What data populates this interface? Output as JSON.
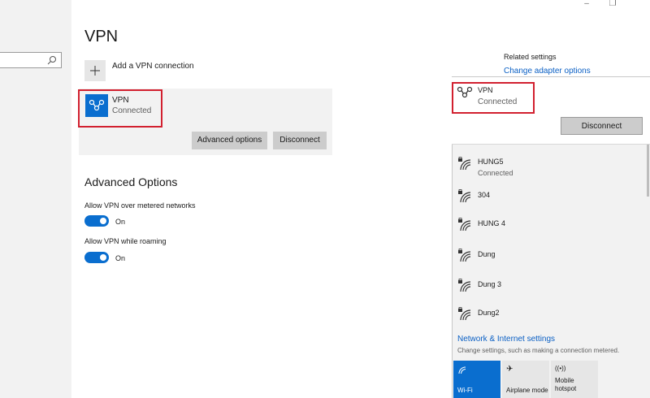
{
  "window_controls": {
    "minimize": "–",
    "restore": "❐"
  },
  "page": {
    "title": "VPN"
  },
  "add_vpn": {
    "label": "Add a VPN connection",
    "icon": "plus-icon"
  },
  "vpn_connection": {
    "name": "VPN",
    "status": "Connected",
    "icon": "vpn-icon",
    "advanced_button": "Advanced options",
    "disconnect_button": "Disconnect"
  },
  "advanced": {
    "title": "Advanced Options",
    "metered": {
      "label": "Allow VPN over metered networks",
      "state": "On",
      "on": true
    },
    "roaming": {
      "label": "Allow VPN while roaming",
      "state": "On",
      "on": true
    }
  },
  "related": {
    "title": "Related settings",
    "link": "Change adapter options"
  },
  "flyout": {
    "vpn": {
      "name": "VPN",
      "status": "Connected",
      "disconnect_button": "Disconnect"
    },
    "networks": [
      {
        "name": "HUNG5",
        "status": "Connected"
      },
      {
        "name": "304",
        "status": ""
      },
      {
        "name": "HUNG 4",
        "status": ""
      },
      {
        "name": "Dung",
        "status": ""
      },
      {
        "name": "Dung 3",
        "status": ""
      },
      {
        "name": "Dung2",
        "status": ""
      }
    ],
    "settings_link": "Network & Internet settings",
    "settings_desc": "Change settings, such as making a connection metered.",
    "tiles": [
      {
        "label": "Wi-Fi",
        "icon": "wifi-icon",
        "active": true
      },
      {
        "label": "Airplane mode",
        "icon": "airplane-icon",
        "active": false
      },
      {
        "label_line1": "Mobile",
        "label_line2": "hotspot",
        "icon": "hotspot-icon",
        "active": false
      }
    ]
  },
  "colors": {
    "accent": "#0a6ecf",
    "highlight_box": "#d2202f",
    "link": "#0a5fc4"
  }
}
